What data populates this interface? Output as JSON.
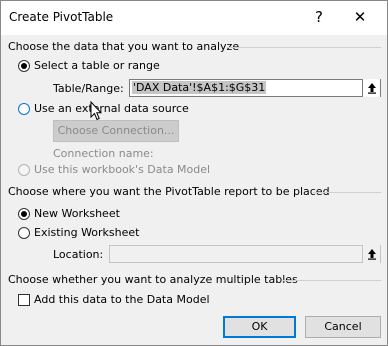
{
  "window": {
    "title": "Create PivotTable",
    "help_label": "?",
    "close_label": "✕"
  },
  "source_section": {
    "heading": "Choose the data that you want to analyze",
    "option_table": "Select a table or range",
    "table_range_label": "Table/Range:",
    "table_range_value": "'DAX Data'!$A$1:$G$31",
    "option_external": "Use an external data source",
    "choose_connection_label": "Choose Connection...",
    "connection_name_label": "Connection name:",
    "option_data_model": "Use this workbook's Data Model"
  },
  "placement_section": {
    "heading": "Choose where you want the PivotTable report to be placed",
    "option_new": "New Worksheet",
    "option_existing": "Existing Worksheet",
    "location_label": "Location:",
    "location_value": ""
  },
  "multi_section": {
    "heading": "Choose whether you want to analyze multiple tables",
    "add_to_model_label": "Add this data to the Data Model"
  },
  "buttons": {
    "ok_label": "OK",
    "cancel_label": "Cancel"
  },
  "state": {
    "selected_source": "table",
    "selected_placement": "new",
    "add_to_model_checked": false
  },
  "colors": {
    "accent": "#0078d7",
    "selection_highlight": "#c5c5c5"
  }
}
